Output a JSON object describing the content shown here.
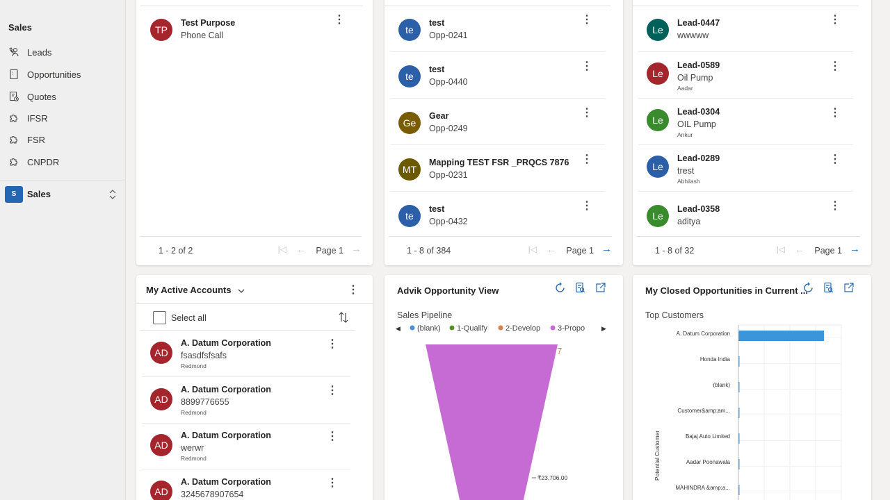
{
  "sidebar": {
    "section_title": "Sales",
    "items": [
      {
        "label": "Leads",
        "icon": "phone-person-icon"
      },
      {
        "label": "Opportunities",
        "icon": "document-icon"
      },
      {
        "label": "Quotes",
        "icon": "quote-document-icon"
      },
      {
        "label": "IFSR",
        "icon": "puzzle-icon"
      },
      {
        "label": "FSR",
        "icon": "puzzle-icon"
      },
      {
        "label": "CNPDR",
        "icon": "puzzle-icon"
      }
    ],
    "area": {
      "badge": "S",
      "name": "Sales"
    }
  },
  "activities": {
    "rows": [
      {
        "initials": "TP",
        "color": "#a4262c",
        "title": "Test Purpose",
        "sub": "Phone Call"
      }
    ],
    "pager": {
      "count": "1 - 2 of 2",
      "page": "Page 1"
    }
  },
  "opportunities": {
    "rows": [
      {
        "initials": "te",
        "color": "#2b5fa8",
        "title": "test",
        "sub": "Opp-0241"
      },
      {
        "initials": "te",
        "color": "#2b5fa8",
        "title": "test",
        "sub": "Opp-0440"
      },
      {
        "initials": "Ge",
        "color": "#7a5c00",
        "title": "Gear",
        "sub": "Opp-0249"
      },
      {
        "initials": "MT",
        "color": "#6b5a00",
        "title": "Mapping TEST FSR _PRQCS 7876",
        "sub": "Opp-0231"
      },
      {
        "initials": "te",
        "color": "#2b5fa8",
        "title": "test",
        "sub": "Opp-0432"
      }
    ],
    "pager": {
      "count": "1 - 8 of 384",
      "page": "Page 1"
    }
  },
  "leads": {
    "rows": [
      {
        "initials": "Le",
        "color": "#00605a",
        "title": "Lead-0447",
        "sub": "wwwww",
        "sub2": ""
      },
      {
        "initials": "Le",
        "color": "#a4262c",
        "title": "Lead-0589",
        "sub": "Oil Pump",
        "sub2": "Aadar"
      },
      {
        "initials": "Le",
        "color": "#3a8a2e",
        "title": "Lead-0304",
        "sub": "OIL Pump",
        "sub2": "Ankur"
      },
      {
        "initials": "Le",
        "color": "#2b5fa8",
        "title": "Lead-0289",
        "sub": "trest",
        "sub2": "Abhilash"
      },
      {
        "initials": "Le",
        "color": "#3a8a2e",
        "title": "Lead-0358",
        "sub": "aditya",
        "sub2": ""
      }
    ],
    "pager": {
      "count": "1 - 8 of 32",
      "page": "Page 1"
    }
  },
  "accounts": {
    "title": "My Active Accounts",
    "select_all": "Select all",
    "rows": [
      {
        "initials": "AD",
        "color": "#a4262c",
        "title": "A. Datum Corporation",
        "sub": "fsasdfsfsafs",
        "sub2": "Redmond"
      },
      {
        "initials": "AD",
        "color": "#a4262c",
        "title": "A. Datum Corporation",
        "sub": "8899776655",
        "sub2": "Redmond"
      },
      {
        "initials": "AD",
        "color": "#a4262c",
        "title": "A. Datum Corporation",
        "sub": "werwr",
        "sub2": "Redmond"
      },
      {
        "initials": "AD",
        "color": "#a4262c",
        "title": "A. Datum Corporation",
        "sub": "3245678907654",
        "sub2": ""
      }
    ]
  },
  "pipeline_chart": {
    "card_title": "Advik Opportunity View",
    "subtitle": "Sales Pipeline",
    "legend": [
      {
        "label": "(blank)",
        "color": "#4a8fd6"
      },
      {
        "label": "1-Qualify",
        "color": "#5b8f2b"
      },
      {
        "label": "2-Develop",
        "color": "#d9804b"
      },
      {
        "label": "3-Propo",
        "color": "#c56bd3"
      }
    ],
    "funnel_label": "₹23,706.00",
    "top_label": "7",
    "funnel_color": "#c56bd3"
  },
  "customers_chart": {
    "card_title": "My Closed Opportunities in Current ...",
    "subtitle": "Top Customers",
    "ylabel": "Potential Customer",
    "bar_color": "#3b95db"
  },
  "chart_data": [
    {
      "type": "bar",
      "title": "Top Customers",
      "ylabel": "Potential Customer",
      "xlabel": "",
      "orientation": "horizontal",
      "categories": [
        "A. Datum Corporation",
        "Honda India",
        "(blank)",
        "Customer&amp;am...",
        "Bajaj Auto Limited",
        "Aadar Poonawala",
        "MAHINDRA &amp;a..."
      ],
      "values": [
        1,
        0.01,
        0.01,
        0.01,
        0.01,
        0.01,
        0.01
      ],
      "grid": true
    },
    {
      "type": "funnel",
      "title": "Sales Pipeline",
      "categories": [
        "3-Propo"
      ],
      "values": [
        23706
      ],
      "data_labels": [
        "₹23,706.00"
      ]
    }
  ]
}
